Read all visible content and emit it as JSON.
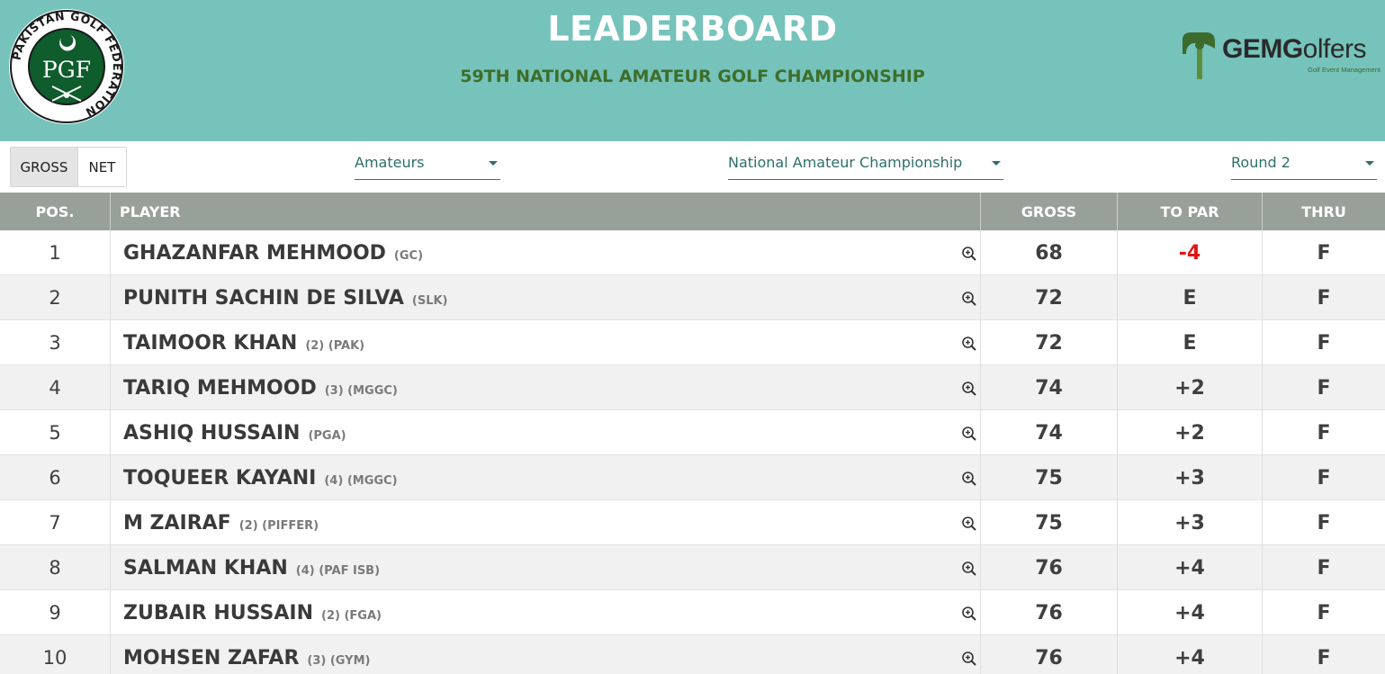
{
  "header": {
    "title": "LEADERBOARD",
    "subtitle": "59TH NATIONAL AMATEUR GOLF CHAMPIONSHIP",
    "left_logo": {
      "ring_text": "PAKISTAN GOLF FEDERATION",
      "monogram": "PGF",
      "icon": "pgf-logo-icon"
    },
    "right_logo": {
      "brand_bold": "GEMG",
      "brand_rest": "olfers",
      "tagline": "Golf Event Management",
      "icon": "gemgolfers-logo-icon"
    }
  },
  "filters": {
    "toggle": {
      "gross": "GROSS",
      "net": "NET",
      "selected": "GROSS"
    },
    "category": "Amateurs",
    "event": "National Amateur Championship",
    "round": "Round 2"
  },
  "table": {
    "headers": {
      "pos": "POS.",
      "player": "PLAYER",
      "gross": "GROSS",
      "to_par": "TO PAR",
      "thru": "THRU"
    },
    "rows": [
      {
        "pos": "1",
        "name": "GHAZANFAR MEHMOOD",
        "meta": "(GC)",
        "gross": "68",
        "to_par": "-4",
        "thru": "F"
      },
      {
        "pos": "2",
        "name": "PUNITH SACHIN DE SILVA",
        "meta": "(SLK)",
        "gross": "72",
        "to_par": "E",
        "thru": "F"
      },
      {
        "pos": "3",
        "name": "TAIMOOR KHAN",
        "meta": "(2)  (PAK)",
        "gross": "72",
        "to_par": "E",
        "thru": "F"
      },
      {
        "pos": "4",
        "name": "TARIQ MEHMOOD",
        "meta": "(3)  (MGGC)",
        "gross": "74",
        "to_par": "+2",
        "thru": "F"
      },
      {
        "pos": "5",
        "name": "ASHIQ HUSSAIN",
        "meta": "(PGA)",
        "gross": "74",
        "to_par": "+2",
        "thru": "F"
      },
      {
        "pos": "6",
        "name": "TOQUEER KAYANI",
        "meta": "(4)  (MGGC)",
        "gross": "75",
        "to_par": "+3",
        "thru": "F"
      },
      {
        "pos": "7",
        "name": "M ZAIRAF",
        "meta": "(2)  (PIFFER)",
        "gross": "75",
        "to_par": "+3",
        "thru": "F"
      },
      {
        "pos": "8",
        "name": "SALMAN KHAN",
        "meta": "  (4)  (PAF ISB)",
        "gross": "76",
        "to_par": "+4",
        "thru": "F"
      },
      {
        "pos": "9",
        "name": "ZUBAIR HUSSAIN",
        "meta": "(2)  (FGA)",
        "gross": "76",
        "to_par": "+4",
        "thru": "F"
      },
      {
        "pos": "10",
        "name": "MOHSEN ZAFAR",
        "meta": "(3)  (GYM)",
        "gross": "76",
        "to_par": "+4",
        "thru": "F"
      }
    ]
  },
  "colors": {
    "header_bg": "#76c3bb",
    "subtitle": "#3e6e2a",
    "table_header_bg": "#98a09a",
    "under_par": "#e11515",
    "row_alt": "#f1f1f1"
  },
  "icons": {
    "row_action": "zoom-in-icon",
    "dropdown": "caret-down-icon"
  }
}
